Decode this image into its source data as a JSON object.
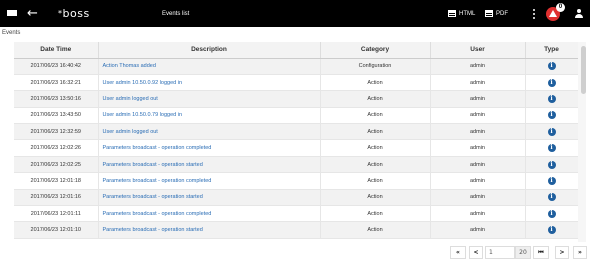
{
  "header": {
    "logo_text": "boss",
    "logo_prefix": "*",
    "title": "Events list",
    "export_html_label": "HTML",
    "export_pdf_label": "PDF",
    "alarm_count": "0",
    "back_glyph": "←"
  },
  "breadcrumb": "Events",
  "table": {
    "columns": [
      "Date Time",
      "Description",
      "Category",
      "User",
      "Type"
    ],
    "rows": [
      {
        "datetime": "2017/06/23 16:40:42",
        "description": "Action Thomas added",
        "category": "Configuration",
        "user": "admin",
        "type": "i"
      },
      {
        "datetime": "2017/06/23 16:32:21",
        "description": "User admin 10.50.0.92 logged in",
        "category": "Action",
        "user": "admin",
        "type": "i"
      },
      {
        "datetime": "2017/06/23 13:50:16",
        "description": "User admin logged out",
        "category": "Action",
        "user": "admin",
        "type": "i"
      },
      {
        "datetime": "2017/06/23 13:43:50",
        "description": "User admin 10.50.0.79 logged in",
        "category": "Action",
        "user": "admin",
        "type": "i"
      },
      {
        "datetime": "2017/06/23 12:32:59",
        "description": "User admin logged out",
        "category": "Action",
        "user": "admin",
        "type": "i"
      },
      {
        "datetime": "2017/06/23 12:02:26",
        "description": "Parameters broadcast - operation completed",
        "category": "Action",
        "user": "admin",
        "type": "i"
      },
      {
        "datetime": "2017/06/23 12:02:25",
        "description": "Parameters broadcast - operation started",
        "category": "Action",
        "user": "admin",
        "type": "i"
      },
      {
        "datetime": "2017/06/23 12:01:18",
        "description": "Parameters broadcast - operation completed",
        "category": "Action",
        "user": "admin",
        "type": "i"
      },
      {
        "datetime": "2017/06/23 12:01:16",
        "description": "Parameters broadcast - operation started",
        "category": "Action",
        "user": "admin",
        "type": "i"
      },
      {
        "datetime": "2017/06/23 12:01:11",
        "description": "Parameters broadcast - operation completed",
        "category": "Action",
        "user": "admin",
        "type": "i"
      },
      {
        "datetime": "2017/06/23 12:01:10",
        "description": "Parameters broadcast - operation started",
        "category": "Action",
        "user": "admin",
        "type": "i"
      }
    ]
  },
  "pagination": {
    "first_label": "«",
    "prev_label": "<",
    "page_value": "1",
    "page_size": "20",
    "play_last_label": "⏮",
    "next_label": ">",
    "last_label": "»"
  },
  "colors": {
    "header_bg": "#000000",
    "link": "#2a6db5",
    "alarm": "#e03030",
    "info_icon": "#1f5f9e"
  }
}
